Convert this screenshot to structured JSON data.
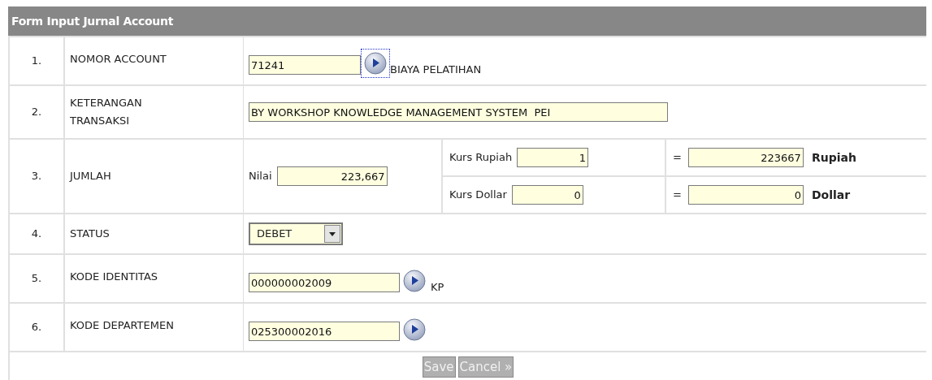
{
  "form": {
    "title": "Form Input Jurnal Account",
    "rows": [
      {
        "kind": "lookup",
        "number": "1.",
        "label": "NOMOR ACCOUNT",
        "value": "71241",
        "focused": true,
        "description": "BIAYA PELATIHAN"
      },
      {
        "kind": "text",
        "number": "2.",
        "label": "KETERANGAN TRANSAKSI",
        "value": "BY WORKSHOP KNOWLEDGE MANAGEMENT SYSTEM  PEI"
      },
      {
        "kind": "amount",
        "number": "3.",
        "label": "JUMLAH",
        "amount_label": "Nilai",
        "amount": "223,667",
        "rates": [
          {
            "label": "Kurs Rupiah",
            "rate": "1",
            "equals": "=",
            "converted": "223667",
            "currency": "Rupiah"
          },
          {
            "label": "Kurs Dollar",
            "rate": "0",
            "equals": "=",
            "converted": "0",
            "currency": "Dollar"
          }
        ]
      },
      {
        "kind": "select",
        "number": "4.",
        "label": "STATUS",
        "value": "DEBET"
      },
      {
        "kind": "lookup",
        "number": "5.",
        "label": "KODE IDENTITAS",
        "value": "000000002009",
        "focused": false,
        "description": "KP"
      },
      {
        "kind": "lookup",
        "number": "6.",
        "label": "KODE DEPARTEMEN",
        "value": "025300002016",
        "focused": false
      }
    ],
    "buttons": [
      {
        "label": "Save",
        "disabled": true
      },
      {
        "label": "Cancel »",
        "disabled": true
      }
    ]
  }
}
